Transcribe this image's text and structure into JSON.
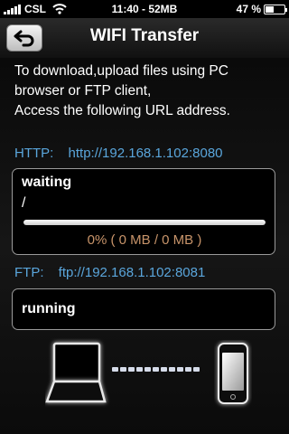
{
  "status_bar": {
    "carrier": "CSL",
    "time_usage": "11:40 - 52MB",
    "battery_pct": "47 %",
    "battery_level": 0.47
  },
  "nav": {
    "title": "WIFI Transfer",
    "back_icon": "back-arrow-icon"
  },
  "intro": {
    "line1": "To download,upload files using PC",
    "line2": "browser or FTP client,",
    "line3": "Access the following URL address."
  },
  "http": {
    "label": "HTTP:",
    "url": "http://192.168.1.102:8080",
    "status": "waiting",
    "path": "/",
    "progress": 0,
    "progress_text": "0% ( 0 MB / 0 MB )"
  },
  "ftp": {
    "label": "FTP:",
    "url": "ftp://192.168.1.102:8081",
    "status": "running"
  },
  "colors": {
    "accent": "#5aa6dc",
    "progress_text": "#c8946a"
  },
  "illustration": {
    "left_icon": "laptop-icon",
    "right_icon": "phone-icon"
  }
}
